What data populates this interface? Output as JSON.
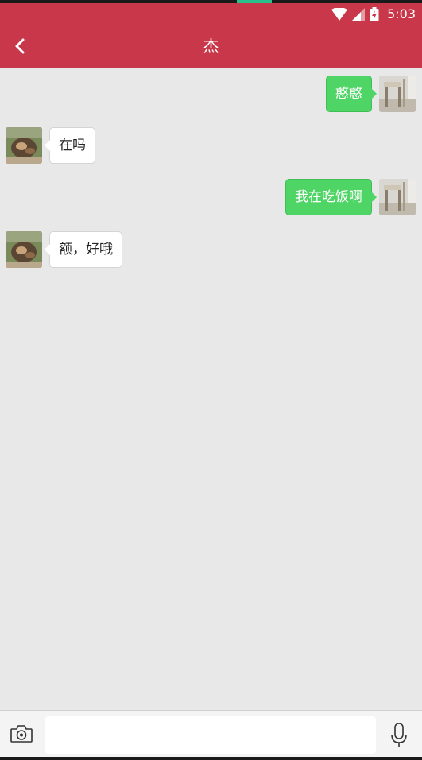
{
  "status_bar": {
    "time": "5:03",
    "icons": [
      "wifi-icon",
      "cell-signal-icon",
      "battery-charging-icon"
    ]
  },
  "app_bar": {
    "title": "杰",
    "back_icon": "back-arrow-icon"
  },
  "messages": [
    {
      "direction": "out",
      "text": "憨憨",
      "avatar": "self-avatar"
    },
    {
      "direction": "in",
      "text": "在吗",
      "avatar": "contact-avatar"
    },
    {
      "direction": "out",
      "text": "我在吃饭啊",
      "avatar": "self-avatar"
    },
    {
      "direction": "in",
      "text": "额，好哦",
      "avatar": "contact-avatar"
    }
  ],
  "input_bar": {
    "camera_icon": "camera-icon",
    "text_value": "",
    "mic_icon": "microphone-icon"
  },
  "colors": {
    "header": "#c9384a",
    "outgoing_bubble": "#4fd466",
    "incoming_bubble": "#ffffff",
    "chat_background": "#e8e8e8"
  }
}
